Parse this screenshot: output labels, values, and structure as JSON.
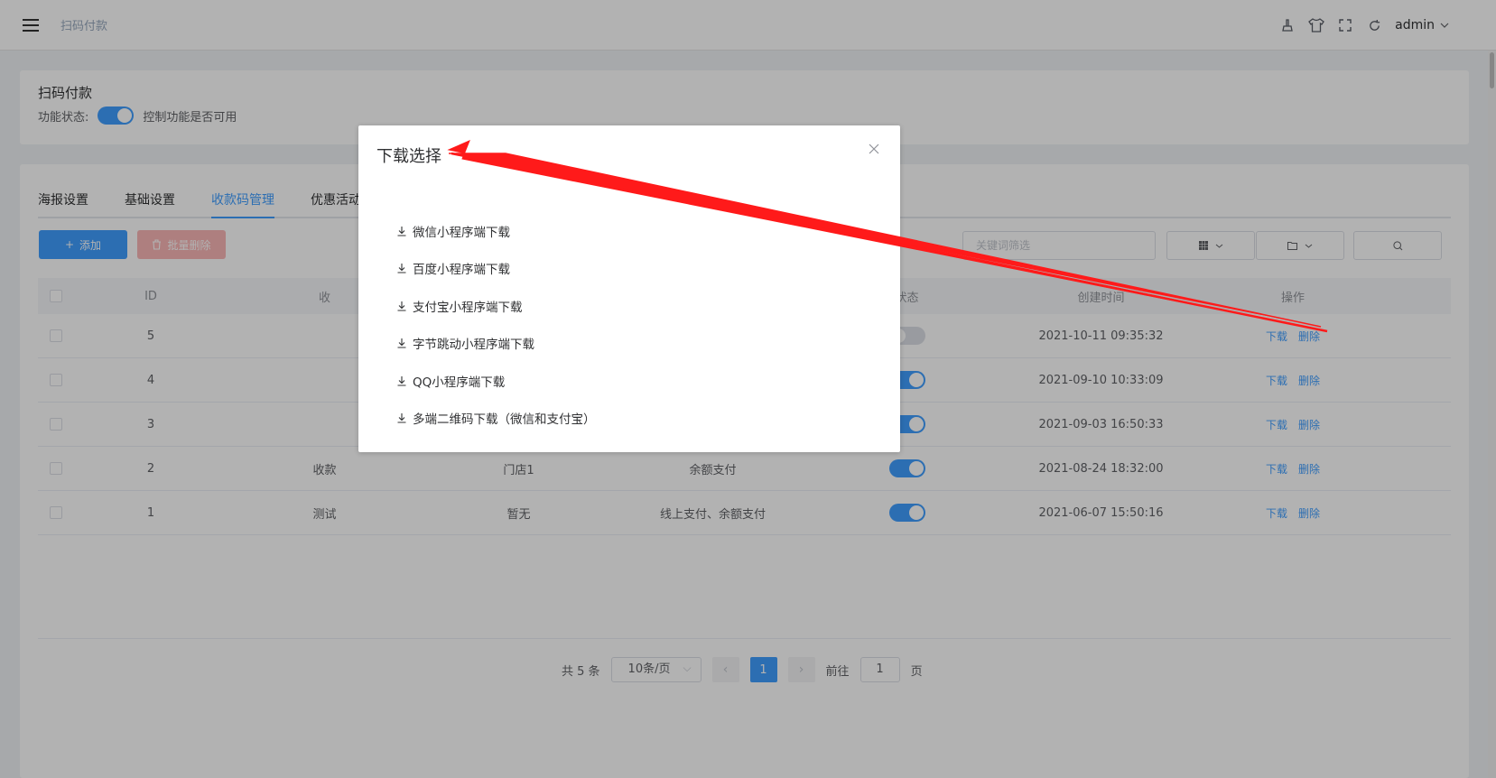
{
  "header": {
    "breadcrumb": "扫码付款",
    "user": "admin"
  },
  "feature": {
    "title": "扫码付款",
    "state_label": "功能状态:",
    "state_hint": "控制功能是否可用"
  },
  "tabs": [
    {
      "label": "海报设置"
    },
    {
      "label": "基础设置"
    },
    {
      "label": "收款码管理"
    },
    {
      "label": "优惠活动"
    }
  ],
  "toolbar": {
    "add_label": "添加",
    "batch_delete_label": "批量删除",
    "search_placeholder": "关键词筛选"
  },
  "table": {
    "columns": {
      "id": "ID",
      "name": "收",
      "state": "状态",
      "created": "创建时间",
      "ops": "操作"
    },
    "rows": [
      {
        "id": "5",
        "name": "",
        "store": "",
        "pay": "",
        "enabled": false,
        "created": "2021-10-11 09:35:32",
        "download": "下载",
        "delete": "删除"
      },
      {
        "id": "4",
        "name": "",
        "store": "",
        "pay": "",
        "enabled": true,
        "created": "2021-09-10 10:33:09",
        "download": "下载",
        "delete": "删除"
      },
      {
        "id": "3",
        "name": "",
        "store": "",
        "pay": "",
        "enabled": true,
        "created": "2021-09-03 16:50:33",
        "download": "下载",
        "delete": "删除"
      },
      {
        "id": "2",
        "name": "收款",
        "store": "门店1",
        "pay": "余额支付",
        "enabled": true,
        "created": "2021-08-24 18:32:00",
        "download": "下载",
        "delete": "删除"
      },
      {
        "id": "1",
        "name": "测试",
        "store": "暂无",
        "pay": "线上支付、余额支付",
        "enabled": true,
        "created": "2021-06-07 15:50:16",
        "download": "下载",
        "delete": "删除"
      }
    ]
  },
  "pagination": {
    "total_text": "共 5 条",
    "page_size": "10条/页",
    "current": "1",
    "goto_label": "前往",
    "goto_value": "1",
    "page_unit": "页"
  },
  "dialog": {
    "title": "下载选择",
    "items": [
      {
        "label": "微信小程序端下载"
      },
      {
        "label": "百度小程序端下载"
      },
      {
        "label": "支付宝小程序端下载"
      },
      {
        "label": "字节跳动小程序端下载"
      },
      {
        "label": "QQ小程序端下载"
      },
      {
        "label": "多端二维码下载（微信和支付宝）"
      }
    ]
  },
  "colors": {
    "primary": "#409eff",
    "danger_light": "#fab6b6",
    "arrow": "#ff1a1a"
  }
}
